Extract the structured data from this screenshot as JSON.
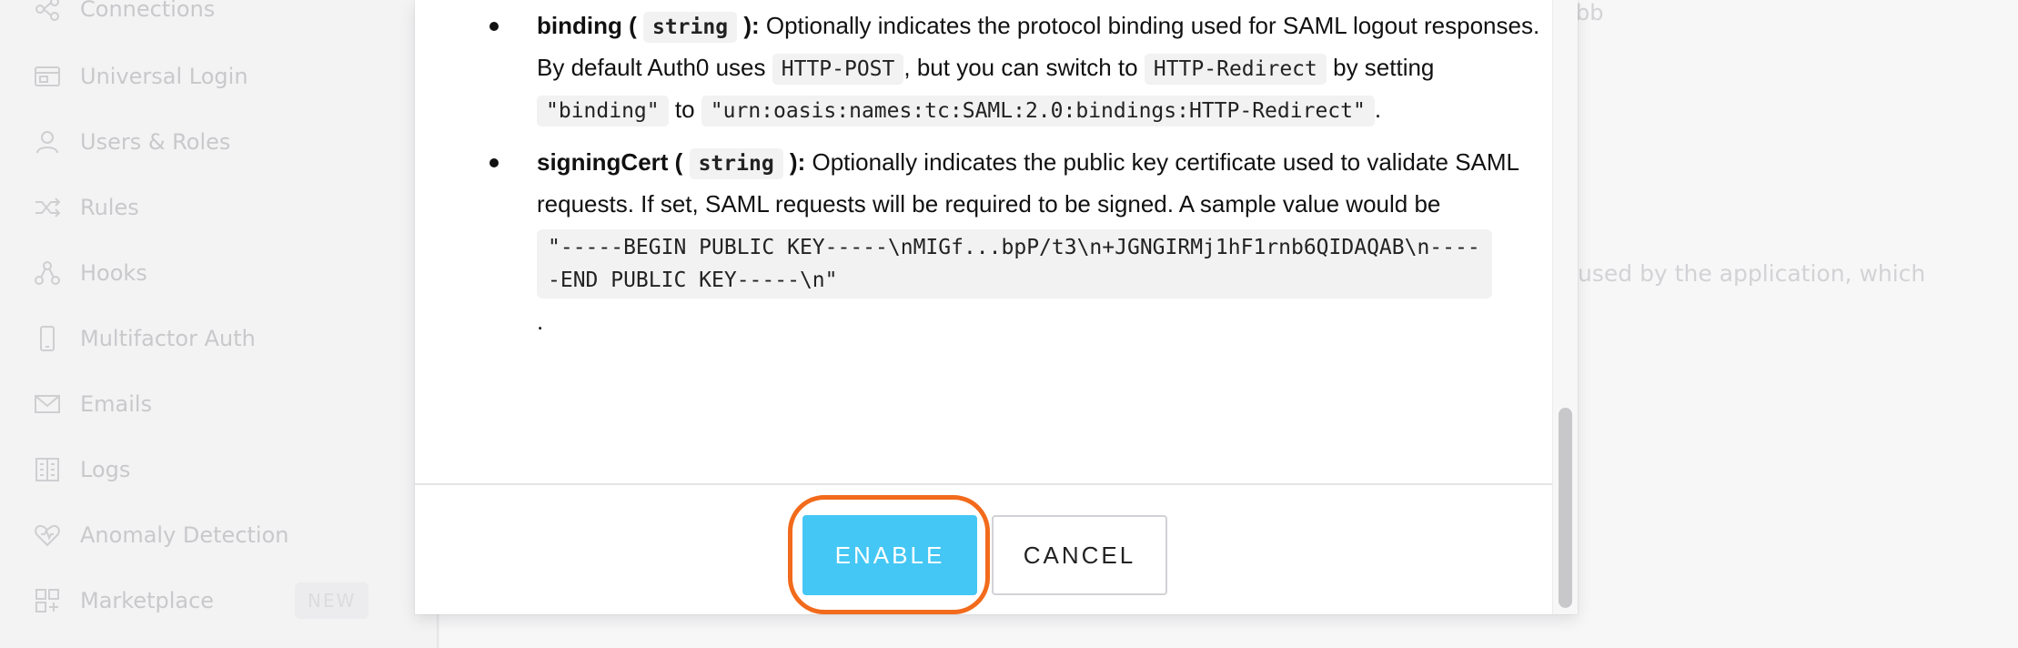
{
  "sidebar": {
    "items": [
      {
        "label": "Connections",
        "icon": "connections-icon"
      },
      {
        "label": "Universal Login",
        "icon": "universal-login-icon"
      },
      {
        "label": "Users & Roles",
        "icon": "users-icon"
      },
      {
        "label": "Rules",
        "icon": "rules-icon"
      },
      {
        "label": "Hooks",
        "icon": "hooks-icon"
      },
      {
        "label": "Multifactor Auth",
        "icon": "phone-icon"
      },
      {
        "label": "Emails",
        "icon": "mail-icon"
      },
      {
        "label": "Logs",
        "icon": "logs-icon"
      },
      {
        "label": "Anomaly Detection",
        "icon": "heart-icon"
      },
      {
        "label": "Marketplace",
        "icon": "grid-icon",
        "badge": "NEW"
      }
    ]
  },
  "background": {
    "text_top": "bb",
    "text_mid": "used by the application, which"
  },
  "modal": {
    "binding": {
      "term": "binding (",
      "type": "string",
      "term_close": "):",
      "text1": "Optionally indicates the protocol binding used for SAML logout responses. By default Auth0 uses",
      "code1": "HTTP-POST",
      "text2": ", but you can switch to",
      "code2": "HTTP-Redirect",
      "text3": "by setting",
      "code3": "\"binding\"",
      "text4": "to",
      "code4": "\"urn:oasis:names:tc:SAML:2.0:bindings:HTTP-Redirect\"",
      "text5": "."
    },
    "signing_cert": {
      "term": "signingCert (",
      "type": "string",
      "term_close": "):",
      "text1": "Optionally indicates the public key certificate used to validate SAML requests. If set, SAML requests will be required to be signed. A sample value would be",
      "code_block": "\"-----BEGIN PUBLIC KEY-----\\nMIGf...bpP/t3\\n+JGNGIRMj1hF1rnb6QIDAQAB\\n-----END PUBLIC KEY-----\\n\"",
      "period": "."
    },
    "buttons": {
      "enable": "ENABLE",
      "cancel": "CANCEL"
    }
  },
  "colors": {
    "accent": "#44c7f4",
    "highlight": "#f26a1b"
  }
}
